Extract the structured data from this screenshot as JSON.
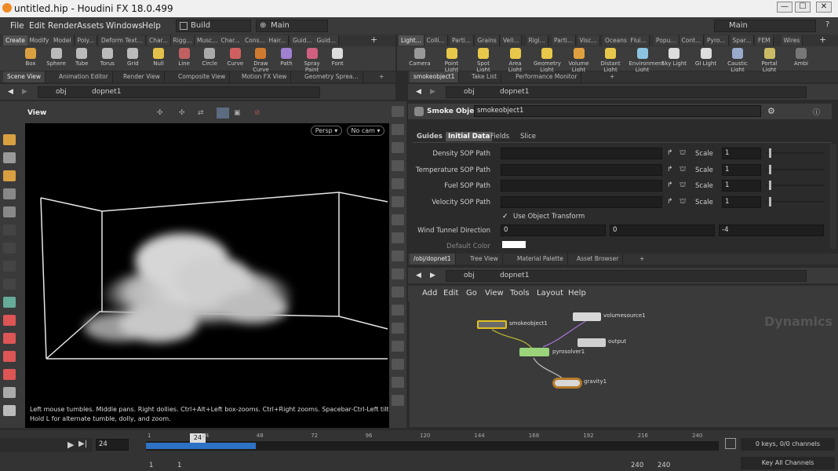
{
  "window": {
    "title": "untitled.hip - Houdini FX 18.0.499",
    "buttons": [
      "—",
      "☐",
      "✕"
    ]
  },
  "menubar": {
    "items": [
      "File",
      "Edit",
      "Render",
      "Assets",
      "Windows",
      "Help"
    ],
    "desktop": "Build",
    "desktop2": "Main",
    "right_desktop": "Main",
    "help": "?"
  },
  "shelf_tabs_left": [
    "Create",
    "Modify",
    "Model",
    "Poly...",
    "Deform",
    "Text...",
    "Char...",
    "Rigg...",
    "Musc...",
    "Char...",
    "Cons...",
    "Hair...",
    "Guid...",
    "Guid..."
  ],
  "shelf_tools_left": [
    "Box",
    "Sphere",
    "Tube",
    "Torus",
    "Grid",
    "Null",
    "Line",
    "Circle",
    "Curve",
    "Draw Curve",
    "Path",
    "Spray Paint",
    "Font"
  ],
  "shelf_tabs_right": [
    "Light...",
    "Colli...",
    "Parti...",
    "Grains",
    "Vell...",
    "Rigi...",
    "Parti...",
    "Visc...",
    "Oceans",
    "Flui...",
    "Popu...",
    "Cont...",
    "Pyro...",
    "Spar...",
    "FEM",
    "Wires"
  ],
  "shelf_tools_right": [
    "Camera",
    "Point Light",
    "Spot Light",
    "Area Light",
    "Geometry Light",
    "Volume Light",
    "Distant Light",
    "Environment Light",
    "Sky Light",
    "GI Light",
    "Caustic Light",
    "Portal Light",
    "Ambi"
  ],
  "left_pane": {
    "tabs": [
      "Scene View",
      "Animation Editor",
      "Render View",
      "Composite View",
      "Motion FX View",
      "Geometry Sprea..."
    ],
    "path_obj": "obj",
    "path_node": "dopnet1",
    "view_label": "View",
    "persp": "Persp ▾",
    "camera": "No cam ▾",
    "help_text_1": "Left mouse tumbles. Middle pans. Right dollies. Ctrl+Alt+Left box-zooms. Ctrl+Right zooms. Spacebar-Ctrl-Left tilts.",
    "help_text_2": "Hold L for alternate tumble, dolly, and zoom."
  },
  "param_pane": {
    "tabs": [
      "smokeobject1",
      "Take List",
      "Performance Monitor"
    ],
    "path_obj": "obj",
    "path_node": "dopnet1",
    "node_type": "Smoke Object",
    "node_name": "smokeobject1",
    "subtabs": [
      "Guides",
      "Initial Data",
      "Fields",
      "Slice"
    ],
    "rows": [
      {
        "label": "Density SOP Path",
        "value": "",
        "scale_label": "Scale",
        "scale": "1"
      },
      {
        "label": "Temperature SOP Path",
        "value": "",
        "scale_label": "Scale",
        "scale": "1"
      },
      {
        "label": "Fuel SOP Path",
        "value": "",
        "scale_label": "Scale",
        "scale": "1"
      },
      {
        "label": "Velocity SOP Path",
        "value": "",
        "scale_label": "Scale",
        "scale": "1"
      }
    ],
    "use_object_transform": "Use Object Transform",
    "wind_label": "Wind Tunnel Direction",
    "wind": [
      "0",
      "0",
      "-4"
    ],
    "default_color": "Default Color"
  },
  "network_pane": {
    "tabs": [
      "/obj/dopnet1",
      "Tree View",
      "Material Palette",
      "Asset Browser"
    ],
    "path_obj": "obj",
    "path_node": "dopnet1",
    "menu": [
      "Add",
      "Edit",
      "Go",
      "View",
      "Tools",
      "Layout",
      "Help"
    ],
    "watermark": "Dynamics",
    "nodes": [
      "smokeobject1",
      "volumesource1",
      "output",
      "pyrosolver1",
      "gravity1"
    ]
  },
  "timeline": {
    "frame": "24",
    "marker": "24",
    "ticks": [
      "1",
      "24",
      "48",
      "72",
      "96",
      "120",
      "144",
      "168",
      "192",
      "216",
      "240"
    ],
    "start": "1",
    "start2": "1",
    "end": "240",
    "end2": "240",
    "keys": "0 keys, 0/0 channels",
    "key_all": "Key All Channels"
  }
}
